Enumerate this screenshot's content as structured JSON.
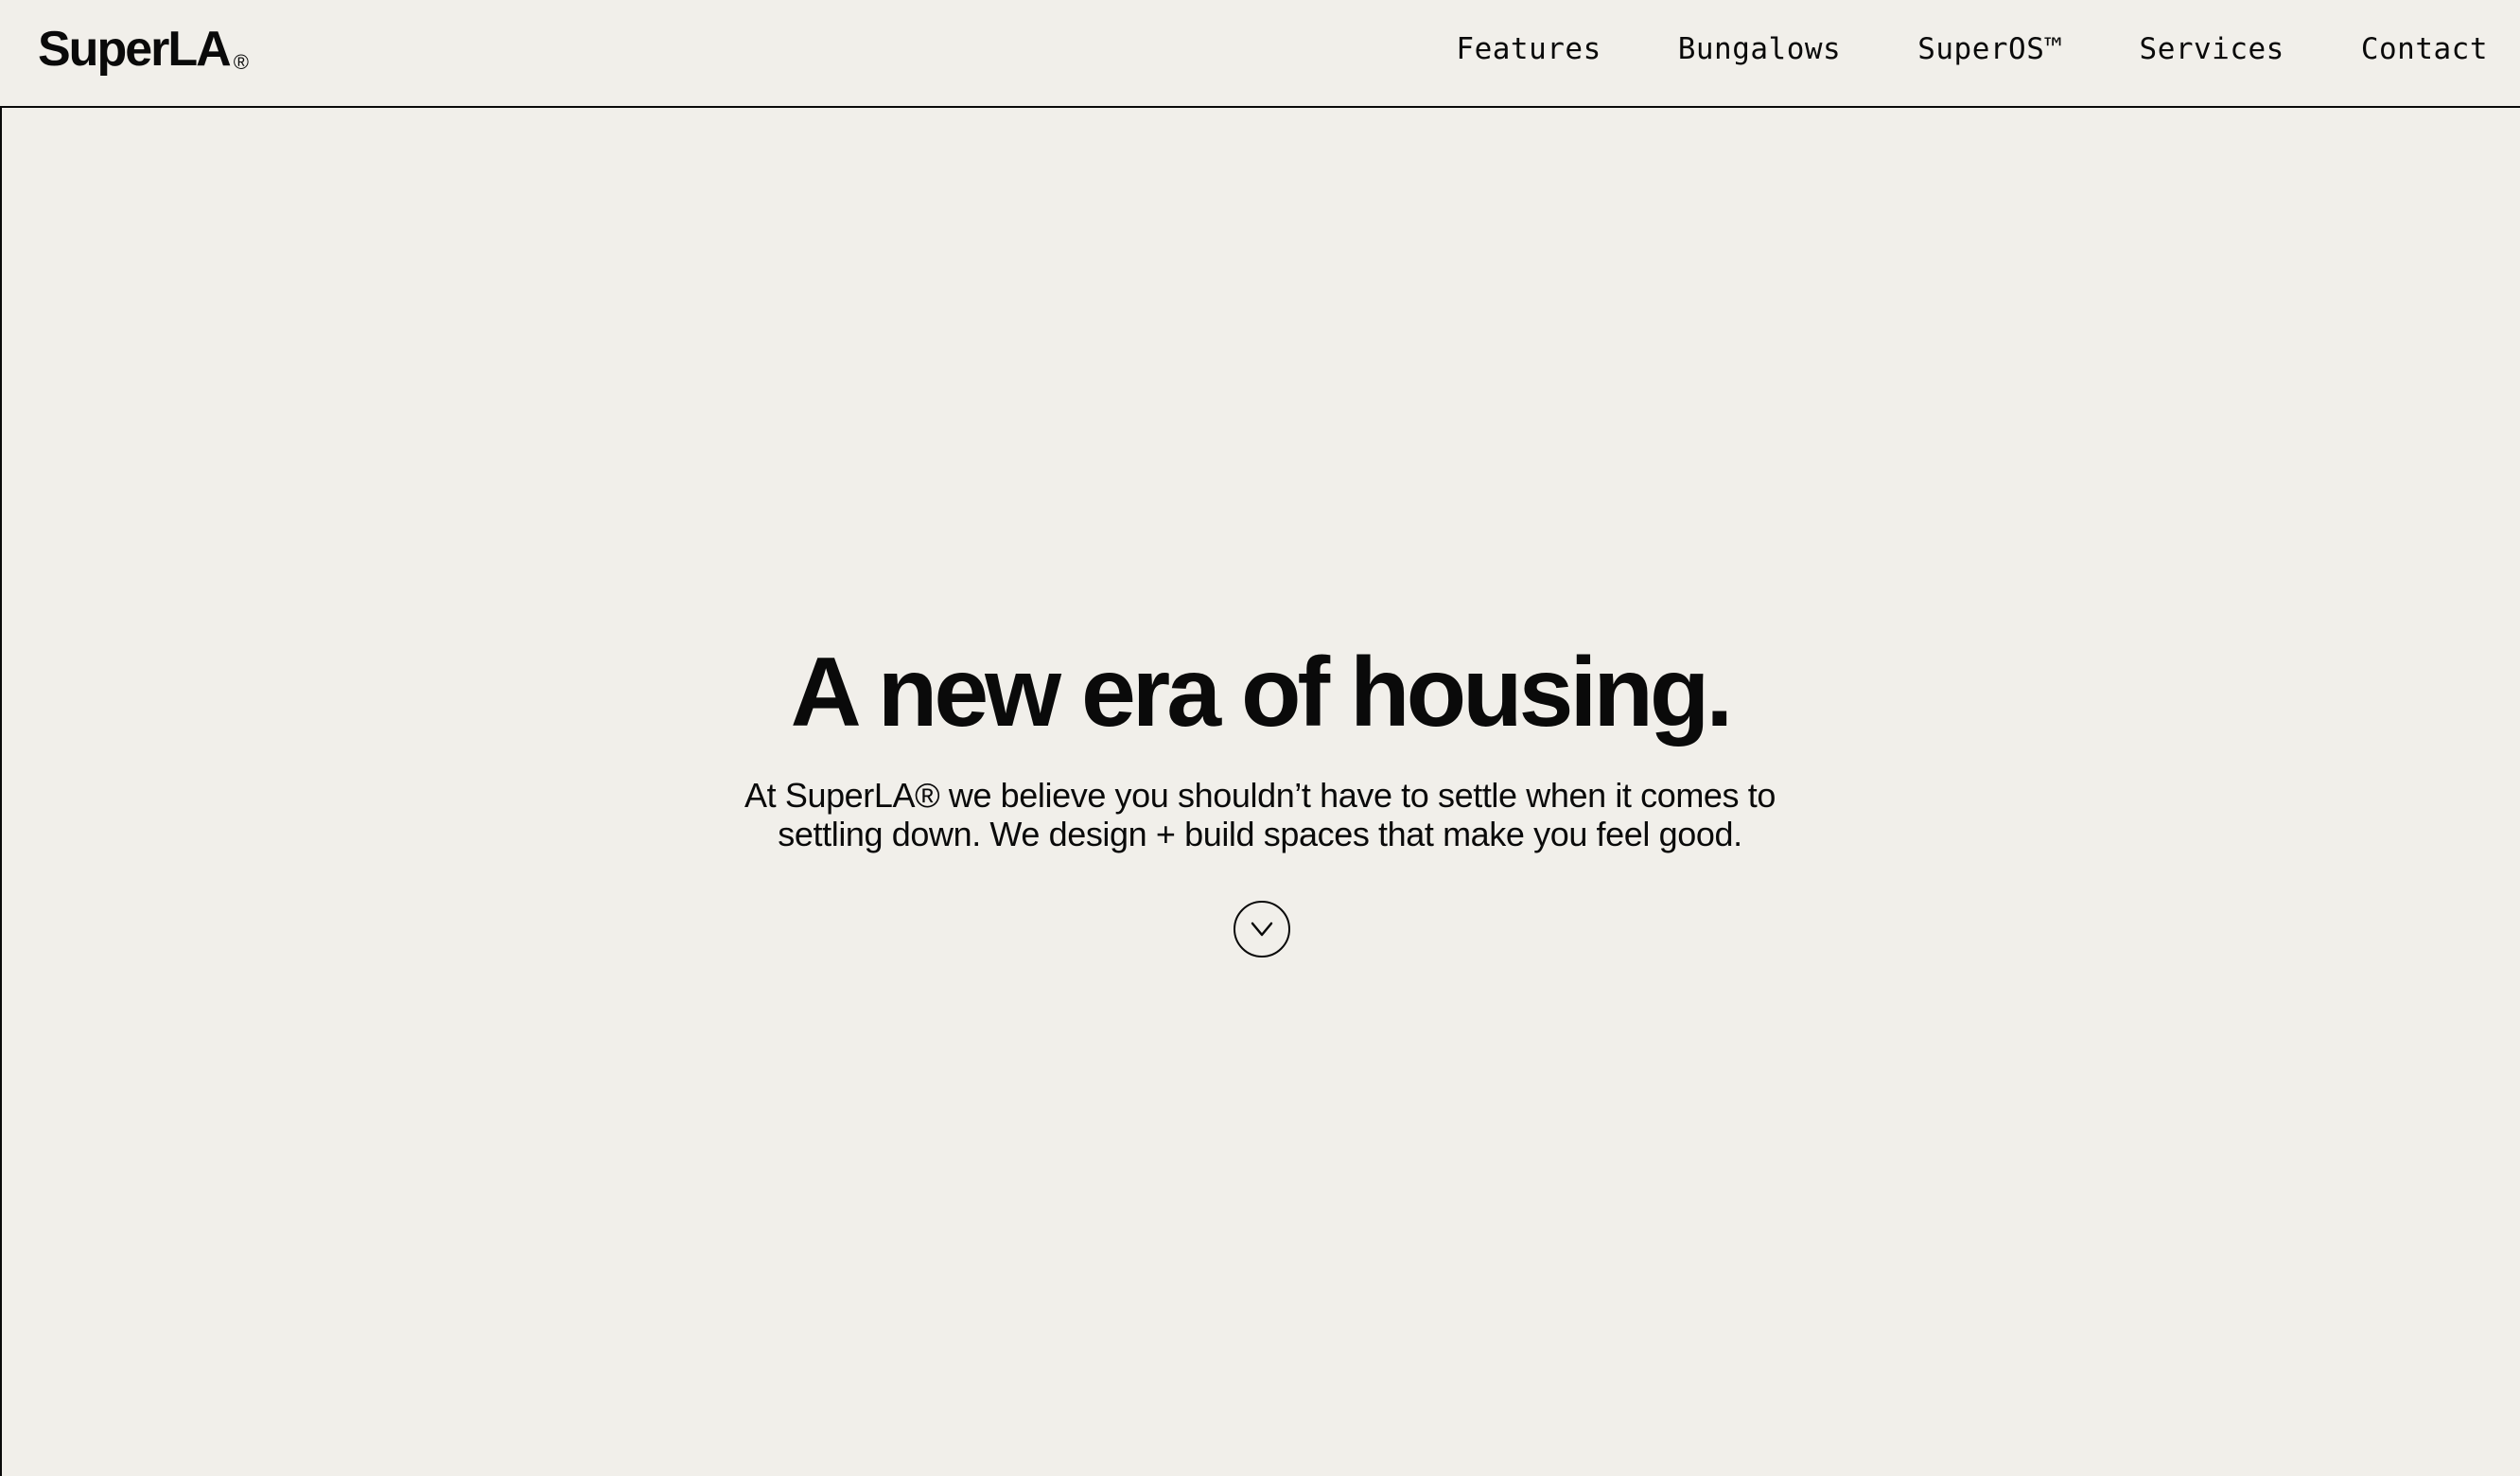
{
  "header": {
    "logo": "SuperLA",
    "logo_mark": "®",
    "nav": [
      {
        "label": "Features"
      },
      {
        "label": "Bungalows"
      },
      {
        "label": "SuperOS™"
      },
      {
        "label": "Services"
      },
      {
        "label": "Contact"
      }
    ]
  },
  "hero": {
    "title": "A new era of housing.",
    "subtitle_line1": "At SuperLA® we believe you shouldn’t have to settle when it comes to",
    "subtitle_line2": "settling down. We design + build spaces that make you feel good.",
    "scroll_icon": "chevron-down-icon"
  },
  "colors": {
    "background": "#f1efea",
    "text": "#0a0a0a"
  }
}
